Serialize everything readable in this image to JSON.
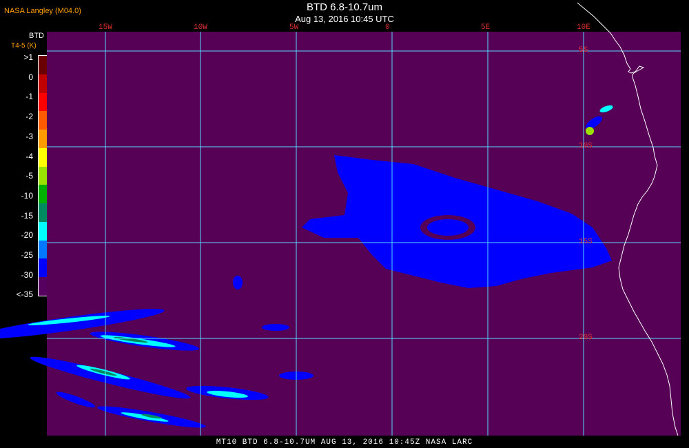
{
  "header": {
    "credit": "NASA Langley (M04.0)",
    "title": "BTD 6.8-10.7um",
    "subtitle": "Aug 13, 2016 10:45 UTC"
  },
  "colorbar": {
    "title": "BTD",
    "unit": "T4-5 (K)",
    "labels": [
      ">1",
      "0",
      "-1",
      "-2",
      "-3",
      "-4",
      "-5",
      "-10",
      "-15",
      "-20",
      "-25",
      "-30",
      "<-35"
    ],
    "colors": [
      "#6a0000",
      "#c00000",
      "#ff0000",
      "#ff5a00",
      "#ff9a00",
      "#ffff00",
      "#9ae000",
      "#00b000",
      "#008a60",
      "#00ffff",
      "#0078ff",
      "#0000ff",
      "#560060"
    ]
  },
  "map": {
    "background": "#560056",
    "grid_color": "#58d8ff",
    "coast_color": "#ffffff",
    "lon_labels": [
      "15W",
      "10W",
      "5W",
      "0",
      "5E",
      "10E"
    ],
    "lat_labels": [
      "5S",
      "10S",
      "15S",
      "20S"
    ]
  },
  "footer": "MT10  BTD 6.8-10.7UM   AUG 13, 2016 10:45Z   NASA LARC"
}
